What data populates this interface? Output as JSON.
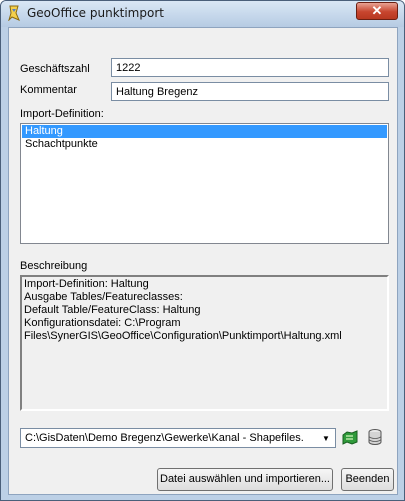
{
  "window": {
    "title": "GeoOffice punktimport",
    "close_label": "✕"
  },
  "fields": {
    "geschaeftszahl": {
      "label": "Geschäftszahl",
      "value": "1222"
    },
    "kommentar": {
      "label": "Kommentar",
      "value": "Haltung Bregenz"
    }
  },
  "import_definition": {
    "label": "Import-Definition:",
    "items": [
      {
        "label": "Haltung",
        "selected": true
      },
      {
        "label": "Schachtpunkte",
        "selected": false
      }
    ]
  },
  "beschreibung": {
    "label": "Beschreibung",
    "lines": [
      "Import-Definition: Haltung",
      "Ausgabe Tables/Featureclasses:",
      "Default Table/FeatureClass: Haltung",
      "Konfigurationsdatei: C:\\Program",
      "Files\\SynerGIS\\GeoOffice\\Configuration\\Punktimport\\Haltung.xml"
    ]
  },
  "path_select": {
    "value": "C:\\GisDaten\\Demo Bregenz\\Gewerke\\Kanal - Shapefiles."
  },
  "icons": {
    "app": "geooffice-app-icon",
    "shapefile": "shapefile-icon",
    "database": "database-icon",
    "dropdown": "chevron-down-icon"
  },
  "buttons": {
    "import": "Datei auswählen und importieren...",
    "exit": "Beenden"
  },
  "colors": {
    "selection": "#3399ff",
    "close": "#c7452e",
    "client_bg": "#f0f0f0"
  }
}
